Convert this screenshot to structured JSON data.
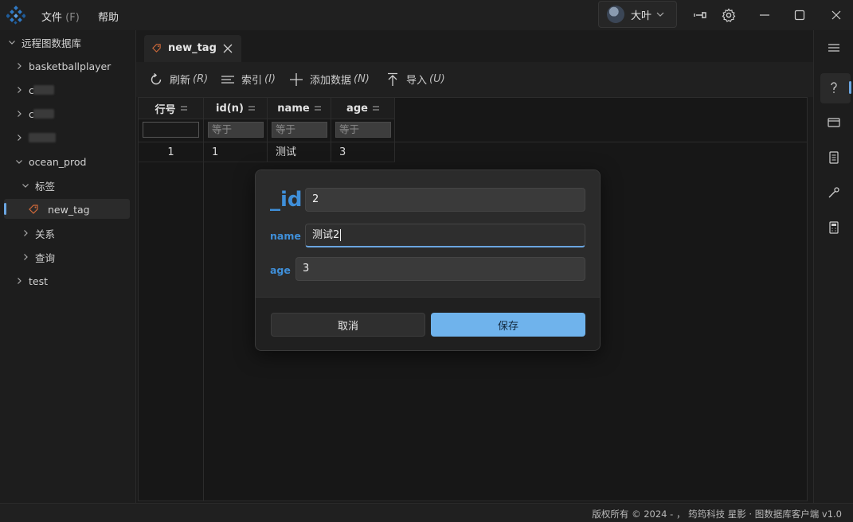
{
  "menu": {
    "file": "文件",
    "file_acc": "(F)",
    "help": "帮助"
  },
  "user": {
    "name": "大叶"
  },
  "sidebar": {
    "root": "远程图数据库",
    "items": [
      {
        "label": "basketballplayer"
      },
      {
        "label": "c"
      },
      {
        "label": "c"
      },
      {
        "label": ""
      },
      {
        "label": "ocean_prod"
      }
    ],
    "tags_group": "标签",
    "selected_tag": "new_tag",
    "relations_group": "关系",
    "query_group": "查询",
    "test": "test"
  },
  "tab": {
    "label": "new_tag"
  },
  "toolbar": {
    "refresh": "刷新",
    "refresh_acc": "(R)",
    "index": "索引",
    "index_acc": "(I)",
    "add": "添加数据",
    "add_acc": "(N)",
    "import": "导入",
    "import_acc": "(U)"
  },
  "table": {
    "columns": [
      "行号",
      "id(n)",
      "name",
      "age"
    ],
    "filter_placeholder": "等于",
    "rows": [
      {
        "row": "1",
        "id": "1",
        "name": "测试",
        "age": "3"
      }
    ]
  },
  "dialog": {
    "id_label": "_id",
    "id_value": "2",
    "name_label": "name",
    "name_value": "测试2",
    "age_label": "age",
    "age_value": "3",
    "cancel": "取消",
    "save": "保存"
  },
  "status": {
    "text": "版权所有 © 2024 - ， 筠筠科技 星影 · 图数据库客户端 v1.0"
  },
  "colors": {
    "accent": "#3f8fd9",
    "save_button": "#6fb3ec",
    "background": "#1b1b1b"
  }
}
